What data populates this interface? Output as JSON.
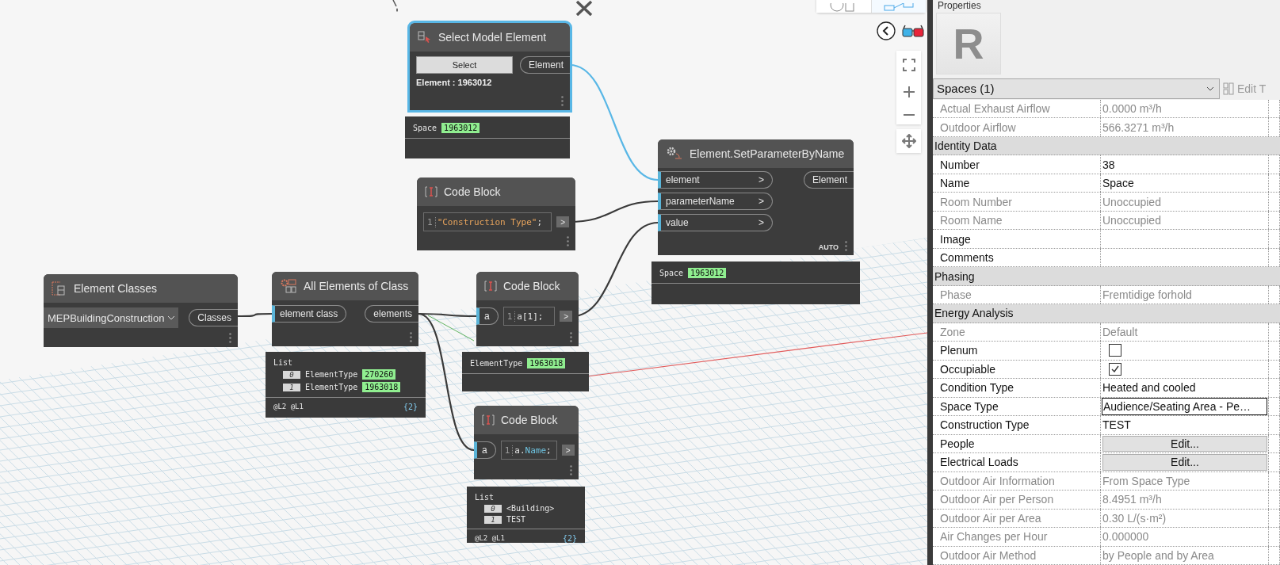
{
  "canvas": {
    "view_buttons": [
      {
        "selected": false
      },
      {
        "selected": true
      }
    ],
    "nodes": [
      {
        "kind": "select",
        "title": "Select Model Element",
        "selected": true,
        "button": "Select",
        "info": "Element : 1963012",
        "outputs": [
          "Element"
        ],
        "preview": {
          "kind": "value",
          "type": "Space",
          "value": "1963012"
        }
      },
      {
        "kind": "code",
        "title": "Code Block",
        "selected": false,
        "line": "1",
        "tokens": [
          {
            "kind": "string",
            "text": "\"Construction Type\""
          },
          {
            "kind": "plain",
            "text": ";"
          }
        ],
        "output": ">"
      },
      {
        "kind": "function",
        "title": "Element.SetParameterByName",
        "selected": false,
        "inputs": [
          {
            "name": "element",
            "arrow": ">"
          },
          {
            "name": "parameterName",
            "arrow": ">"
          },
          {
            "name": "value",
            "arrow": ">"
          }
        ],
        "outputs": [
          "Element"
        ],
        "lacing": "AUTO",
        "preview": {
          "kind": "value",
          "type": "Space",
          "value": "1963012"
        }
      },
      {
        "kind": "dropdown",
        "title": "Element Classes",
        "selected": false,
        "value": "MEPBuildingConstruction",
        "outputs": [
          "Classes"
        ]
      },
      {
        "kind": "function",
        "title": "All Elements of Class",
        "selected": false,
        "inputs": [
          {
            "name": "element class"
          }
        ],
        "outputs": [
          "elements"
        ],
        "preview": {
          "kind": "list",
          "heading": "List",
          "items": [
            {
              "index": "0",
              "label": "ElementType",
              "value": "270260"
            },
            {
              "index": "1",
              "label": "ElementType",
              "value": "1963018"
            }
          ],
          "levels": "@L2 @L1",
          "count": "{2}"
        }
      },
      {
        "kind": "code",
        "title": "Code Block",
        "selected": false,
        "inputs": [
          {
            "name": "a"
          }
        ],
        "line": "1",
        "tokens": [
          {
            "kind": "plain",
            "text": "a[1];"
          }
        ],
        "output": ">",
        "preview": {
          "kind": "value",
          "type": "ElementType",
          "value": "1963018"
        }
      },
      {
        "kind": "code",
        "title": "Code Block",
        "selected": false,
        "inputs": [
          {
            "name": "a"
          }
        ],
        "line": "1",
        "tokens": [
          {
            "kind": "plain",
            "text": "a."
          },
          {
            "kind": "property",
            "text": "Name"
          },
          {
            "kind": "plain",
            "text": ";"
          }
        ],
        "output": ">",
        "preview": {
          "kind": "list",
          "heading": "List",
          "items": [
            {
              "index": "0",
              "label": "<Building>"
            },
            {
              "index": "1",
              "label": "TEST"
            }
          ],
          "levels": "@L2 @L1",
          "count": "{2}"
        }
      }
    ]
  },
  "panel": {
    "title": "Properties",
    "logo": "R",
    "type_selector": "Spaces (1)",
    "edit_type": "Edit T",
    "rows": [
      {
        "kind": "text",
        "label": "Actual Exhaust Airflow",
        "value": "0.0000 m³/h",
        "readonly": true
      },
      {
        "kind": "text",
        "label": "Outdoor Airflow",
        "value": "566.3271 m³/h",
        "readonly": true
      },
      {
        "kind": "group",
        "label": "Identity Data"
      },
      {
        "kind": "text",
        "label": "Number",
        "value": "38",
        "readonly": false
      },
      {
        "kind": "text",
        "label": "Name",
        "value": "Space",
        "readonly": false
      },
      {
        "kind": "text",
        "label": "Room Number",
        "value": "Unoccupied",
        "readonly": true
      },
      {
        "kind": "text",
        "label": "Room Name",
        "value": "Unoccupied",
        "readonly": true
      },
      {
        "kind": "text",
        "label": "Image",
        "readonly": false
      },
      {
        "kind": "text",
        "label": "Comments",
        "readonly": false
      },
      {
        "kind": "group",
        "label": "Phasing"
      },
      {
        "kind": "text",
        "label": "Phase",
        "value": "Fremtidige forhold",
        "readonly": true
      },
      {
        "kind": "group",
        "label": "Energy Analysis"
      },
      {
        "kind": "text",
        "label": "Zone",
        "value": "Default",
        "readonly": true
      },
      {
        "kind": "checkbox",
        "label": "Plenum",
        "checked": false,
        "readonly": false
      },
      {
        "kind": "checkbox",
        "label": "Occupiable",
        "checked": true,
        "readonly": false
      },
      {
        "kind": "text",
        "label": "Condition Type",
        "value": "Heated and cooled",
        "readonly": false
      },
      {
        "kind": "field",
        "label": "Space Type",
        "value": "Audience/Seating Area - Pe…",
        "readonly": false
      },
      {
        "kind": "text",
        "label": "Construction Type",
        "value": "TEST",
        "readonly": false
      },
      {
        "kind": "button",
        "label": "People",
        "value": "Edit...",
        "readonly": false
      },
      {
        "kind": "button",
        "label": "Electrical Loads",
        "value": "Edit...",
        "readonly": false
      },
      {
        "kind": "text",
        "label": "Outdoor Air Information",
        "value": "From Space Type",
        "readonly": true
      },
      {
        "kind": "text",
        "label": "Outdoor Air per Person",
        "value": "8.4951 m³/h",
        "readonly": true
      },
      {
        "kind": "text",
        "label": "Outdoor Air per Area",
        "value": "0.30 L/(s·m²)",
        "readonly": true
      },
      {
        "kind": "text",
        "label": "Air Changes per Hour",
        "value": "0.000000",
        "readonly": true
      },
      {
        "kind": "text",
        "label": "Outdoor Air Method",
        "value": "by People and by Area",
        "readonly": true
      }
    ]
  }
}
